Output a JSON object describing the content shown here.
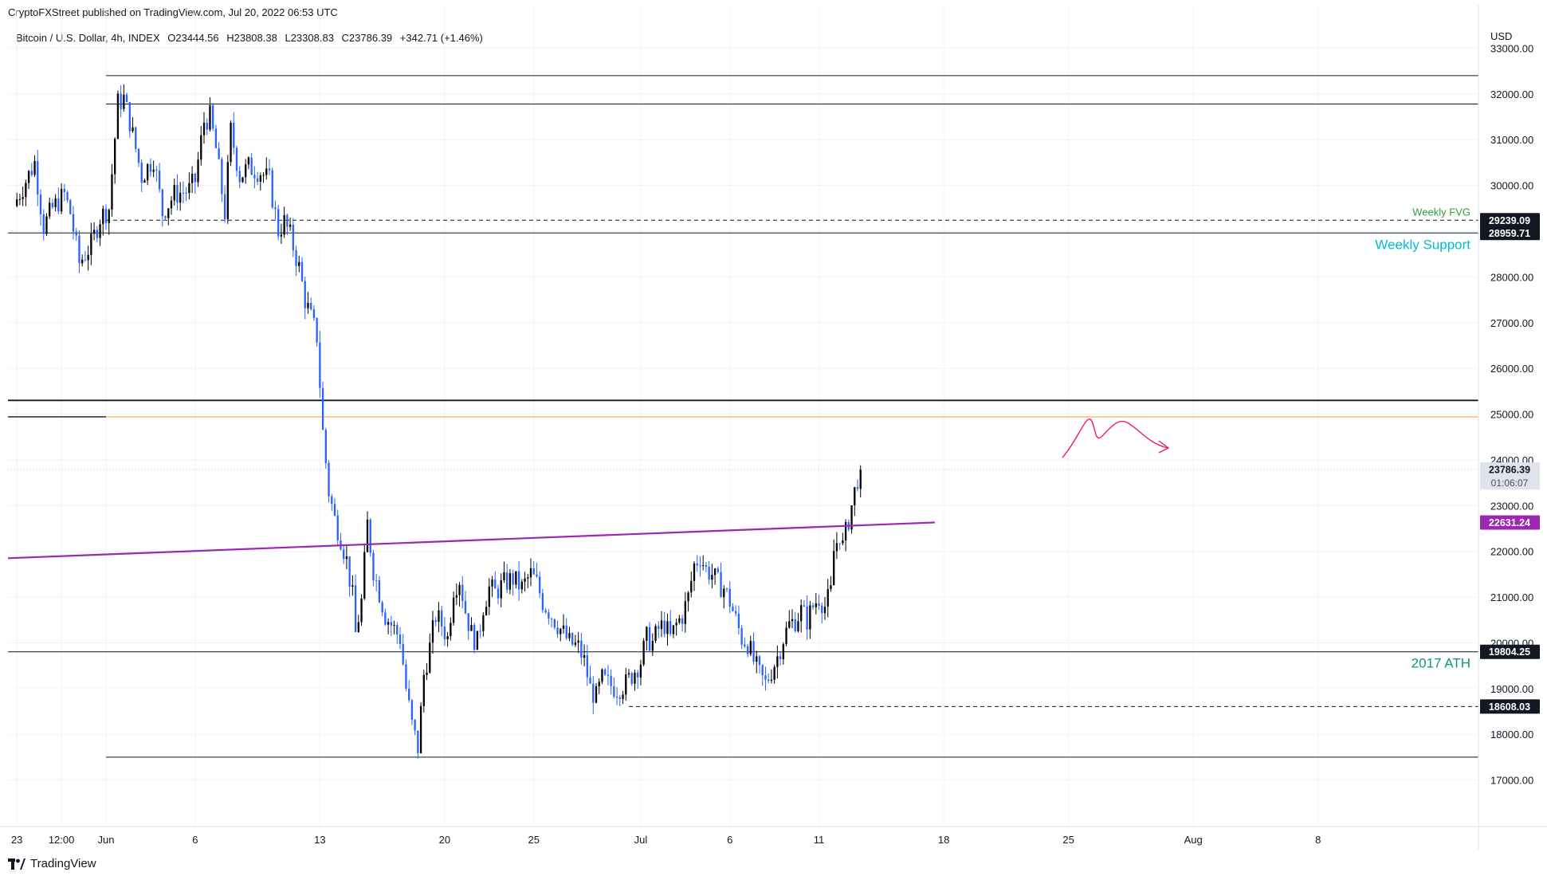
{
  "header": {
    "published": "CryptoFXStreet published on TradingView.com, Jul 20, 2022 06:53 UTC",
    "symbol": "Bitcoin / U.S. Dollar, 4h, INDEX",
    "open": "O23444.56",
    "high": "H23808.38",
    "low": "L23308.83",
    "close": "C23786.39",
    "change": "+342.71 (+1.46%)"
  },
  "footer": {
    "brand": "TradingView"
  },
  "colors": {
    "up_candle": "#000000",
    "down_candle": "#2962ff",
    "trendline": "#9c27b0",
    "fvg": "#2e9e3e",
    "support": "#00bcd4",
    "ath": "#089981",
    "arrow": "#e91e63"
  },
  "chart_data": {
    "type": "candlestick",
    "title": "",
    "currency": "USD",
    "y_ticks": [
      17000,
      18000,
      19000,
      20000,
      21000,
      22000,
      23000,
      24000,
      25000,
      26000,
      27000,
      28000,
      29000,
      30000,
      31000,
      32000,
      33000
    ],
    "y_tick_labels": [
      "17000.00",
      "18000.00",
      "19000.00",
      "20000.00",
      "21000.00",
      "22000.00",
      "23000.00",
      "24000.00",
      "25000.00",
      "26000.00",
      "27000.00",
      "28000.00",
      "29000.00",
      "30000.00",
      "31000.00",
      "32000.00",
      "33000.00"
    ],
    "ylim": [
      16000,
      33600
    ],
    "x_ticks": [
      {
        "label": "23",
        "bar": 0
      },
      {
        "label": "12:00",
        "bar": 15
      },
      {
        "label": "Jun",
        "bar": 30
      },
      {
        "label": "6",
        "bar": 60
      },
      {
        "label": "13",
        "bar": 102
      },
      {
        "label": "20",
        "bar": 144
      },
      {
        "label": "25",
        "bar": 174
      },
      {
        "label": "Jul",
        "bar": 210
      },
      {
        "label": "6",
        "bar": 240
      },
      {
        "label": "11",
        "bar": 270
      },
      {
        "label": "18",
        "bar": 312
      },
      {
        "label": "25",
        "bar": 354
      },
      {
        "label": "Aug",
        "bar": 396
      },
      {
        "label": "8",
        "bar": 438
      }
    ],
    "x_range_bars": [
      -3,
      492
    ],
    "close_path": [
      [
        0,
        29700
      ],
      [
        6,
        30500
      ],
      [
        9,
        29100
      ],
      [
        12,
        29500
      ],
      [
        16,
        29800
      ],
      [
        18,
        29400
      ],
      [
        21,
        28300
      ],
      [
        25,
        28700
      ],
      [
        28,
        29300
      ],
      [
        31,
        29500
      ],
      [
        34,
        31800
      ],
      [
        36,
        31900
      ],
      [
        38,
        31400
      ],
      [
        42,
        30200
      ],
      [
        46,
        30600
      ],
      [
        49,
        29400
      ],
      [
        53,
        29800
      ],
      [
        58,
        29900
      ],
      [
        60,
        30100
      ],
      [
        63,
        31400
      ],
      [
        65,
        31500
      ],
      [
        67,
        30800
      ],
      [
        70,
        29400
      ],
      [
        72,
        31200
      ],
      [
        75,
        30200
      ],
      [
        78,
        30400
      ],
      [
        82,
        30300
      ],
      [
        85,
        30100
      ],
      [
        88,
        29000
      ],
      [
        90,
        29200
      ],
      [
        92,
        28900
      ],
      [
        95,
        28200
      ],
      [
        97,
        27500
      ],
      [
        99,
        27100
      ],
      [
        101,
        26700
      ],
      [
        103,
        24600
      ],
      [
        105,
        23300
      ],
      [
        107,
        22700
      ],
      [
        109,
        22300
      ],
      [
        111,
        21800
      ],
      [
        113,
        21000
      ],
      [
        114,
        20200
      ],
      [
        116,
        20900
      ],
      [
        118,
        22600
      ],
      [
        120,
        21600
      ],
      [
        122,
        21100
      ],
      [
        124,
        20600
      ],
      [
        127,
        20300
      ],
      [
        129,
        20100
      ],
      [
        131,
        19000
      ],
      [
        133,
        18200
      ],
      [
        135,
        17700
      ],
      [
        137,
        19300
      ],
      [
        139,
        19900
      ],
      [
        141,
        20600
      ],
      [
        143,
        20400
      ],
      [
        145,
        20100
      ],
      [
        147,
        21200
      ],
      [
        149,
        21400
      ],
      [
        151,
        20700
      ],
      [
        153,
        20200
      ],
      [
        155,
        20000
      ],
      [
        157,
        20800
      ],
      [
        159,
        21200
      ],
      [
        161,
        21100
      ],
      [
        164,
        21300
      ],
      [
        167,
        21400
      ],
      [
        170,
        21200
      ],
      [
        173,
        21500
      ],
      [
        175,
        21300
      ],
      [
        177,
        20900
      ],
      [
        180,
        20600
      ],
      [
        183,
        20300
      ],
      [
        186,
        20000
      ],
      [
        189,
        19900
      ],
      [
        191,
        19600
      ],
      [
        193,
        19000
      ],
      [
        195,
        18800
      ],
      [
        197,
        19200
      ],
      [
        199,
        19100
      ],
      [
        202,
        19000
      ],
      [
        205,
        19100
      ],
      [
        208,
        19400
      ],
      [
        210,
        19600
      ],
      [
        212,
        20100
      ],
      [
        214,
        20000
      ],
      [
        216,
        20300
      ],
      [
        218,
        20400
      ],
      [
        220,
        20100
      ],
      [
        222,
        20400
      ],
      [
        224,
        20600
      ],
      [
        226,
        21000
      ],
      [
        228,
        21700
      ],
      [
        230,
        21900
      ],
      [
        232,
        21600
      ],
      [
        234,
        21500
      ],
      [
        236,
        21300
      ],
      [
        238,
        21200
      ],
      [
        240,
        20900
      ],
      [
        242,
        20500
      ],
      [
        244,
        20100
      ],
      [
        246,
        20000
      ],
      [
        248,
        19600
      ],
      [
        250,
        19300
      ],
      [
        252,
        19100
      ],
      [
        254,
        19400
      ],
      [
        256,
        19700
      ],
      [
        258,
        20100
      ],
      [
        260,
        20400
      ],
      [
        262,
        20500
      ],
      [
        264,
        20700
      ],
      [
        266,
        20500
      ],
      [
        268,
        20800
      ],
      [
        270,
        21000
      ],
      [
        272,
        20800
      ],
      [
        274,
        21100
      ],
      [
        275,
        22000
      ],
      [
        277,
        22400
      ],
      [
        278,
        22100
      ],
      [
        280,
        22700
      ],
      [
        282,
        23300
      ],
      [
        283,
        23600
      ],
      [
        284,
        23786
      ]
    ],
    "horizontal_levels": [
      {
        "price": 32400,
        "style": "solid"
      },
      {
        "price": 31780,
        "style": "solid"
      },
      {
        "price": 29239.09,
        "style": "dashed",
        "label": "Weekly FVG"
      },
      {
        "price": 28959.71,
        "style": "solid",
        "label": "Weekly Support"
      },
      {
        "price": 25300,
        "style": "solid-thick"
      },
      {
        "price": 24940,
        "style": "solid-orange"
      },
      {
        "price": 19804.25,
        "style": "solid",
        "label": "2017 ATH"
      },
      {
        "price": 18608.03,
        "style": "dashed"
      },
      {
        "price": 17500,
        "style": "solid"
      }
    ],
    "trendline": {
      "start": [
        -3,
        21850
      ],
      "end": [
        309,
        22631.24
      ]
    },
    "price_tags": [
      {
        "value": "29239.09",
        "price": 29239.09,
        "bg": "#131722",
        "fg": "#ffffff"
      },
      {
        "value": "28959.71",
        "price": 28959.71,
        "bg": "#131722",
        "fg": "#ffffff"
      },
      {
        "value": "23786.39",
        "price": 23786.39,
        "bg": "#e0e3eb",
        "fg": "#131722",
        "sub": "01:06:07"
      },
      {
        "value": "22631.24",
        "price": 22631.24,
        "bg": "#9c27b0",
        "fg": "#ffffff"
      },
      {
        "value": "19804.25",
        "price": 19804.25,
        "bg": "#131722",
        "fg": "#ffffff"
      },
      {
        "value": "18608.03",
        "price": 18608.03,
        "bg": "#131722",
        "fg": "#ffffff"
      }
    ],
    "annotations": [
      {
        "text": "Weekly FVG",
        "price": 29239.09
      },
      {
        "text": "Weekly Support",
        "price": 28959.71
      },
      {
        "text": "2017 ATH",
        "price": 19804.25
      }
    ],
    "grid": true,
    "legend": "none"
  }
}
